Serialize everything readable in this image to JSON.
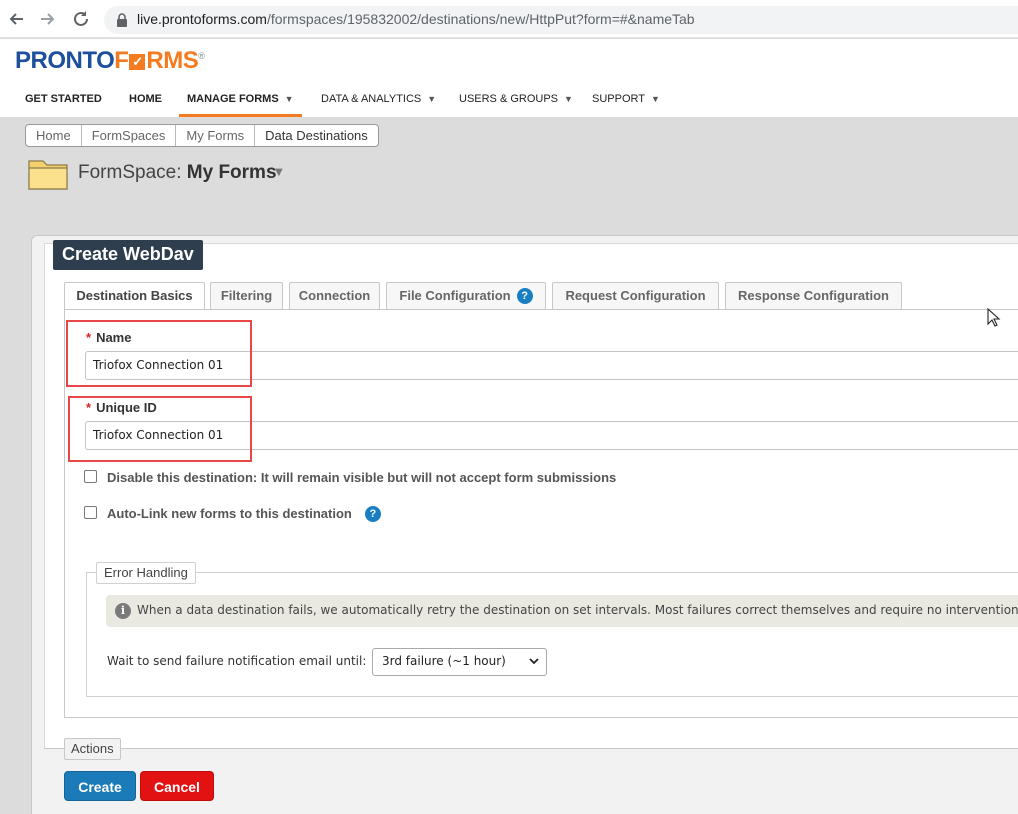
{
  "browser": {
    "url_domain": "live.prontoforms.com",
    "url_path": "/formspaces/195832002/destinations/new/HttpPut?form=#&nameTab"
  },
  "logo": {
    "part1": "PRONTO",
    "part2": "F",
    "part3": "RMS",
    "check": "✓",
    "tm": "®"
  },
  "topnav": {
    "get_started": "GET STARTED",
    "home": "HOME",
    "manage_forms": "MANAGE FORMS",
    "data_analytics": "DATA & ANALYTICS",
    "users_groups": "USERS & GROUPS",
    "support": "SUPPORT",
    "caret": "▼"
  },
  "breadcrumb": [
    "Home",
    "FormSpaces",
    "My Forms",
    "Data Destinations"
  ],
  "formspace": {
    "label": "FormSpace: ",
    "name": "My Forms",
    "caret": "▼"
  },
  "panel_title": "Create WebDav",
  "tabs": [
    "Destination Basics",
    "Filtering",
    "Connection",
    "File Configuration",
    "Request Configuration",
    "Response Configuration"
  ],
  "help_glyph": "?",
  "fields": {
    "required_mark": "*",
    "name_label": "Name",
    "name_value": "Triofox Connection 01",
    "uid_label": "Unique ID",
    "uid_value": "Triofox Connection 01"
  },
  "checkboxes": {
    "disable": "Disable this destination: It will remain visible but will not accept form submissions",
    "autolink": "Auto-Link new forms to this destination",
    "disable_checked": false,
    "autolink_checked": false
  },
  "error_handling": {
    "legend": "Error Handling",
    "info_glyph": "i",
    "info": "When a data destination fails, we automatically retry the destination on set intervals. Most failures correct themselves and require no intervention.",
    "wait_label": "Wait to send failure notification email until:",
    "selected_option": "3rd failure (~1 hour)",
    "chevron": "⌄"
  },
  "actions": {
    "legend": "Actions",
    "create": "Create",
    "cancel": "Cancel"
  },
  "colors": {
    "brand_blue": "#1c4f9c",
    "brand_orange": "#f47b20",
    "header_dark": "#2f3e4e",
    "create_button": "#1b7ab8",
    "cancel_button": "#e31212",
    "highlight": "#e8474a"
  }
}
